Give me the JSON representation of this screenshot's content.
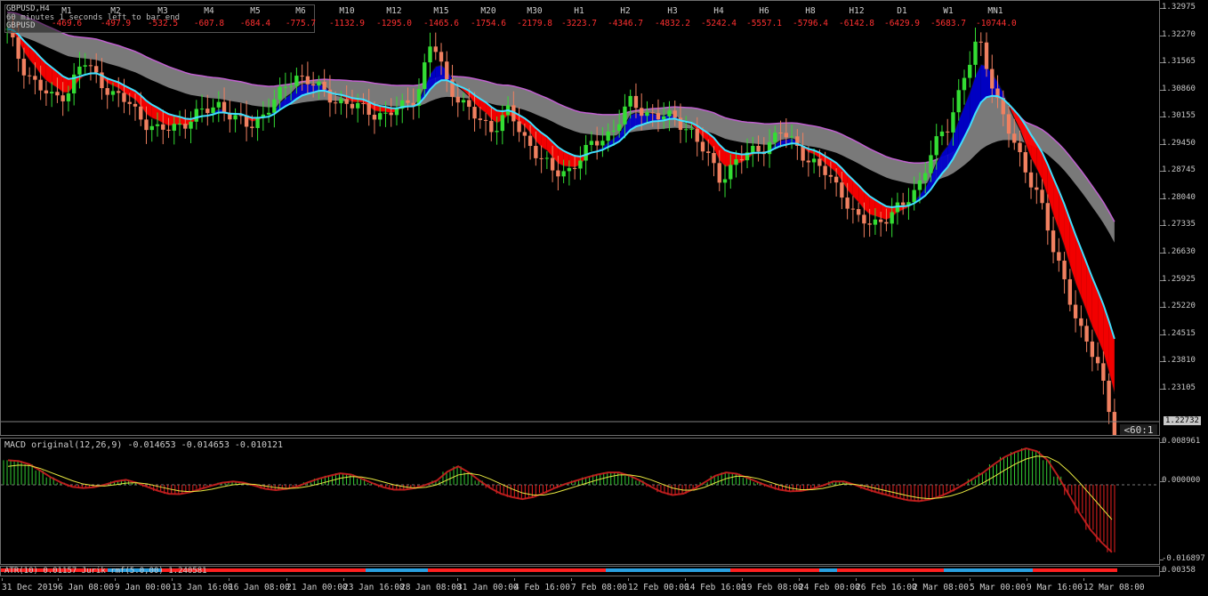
{
  "chart_title": "GBPUSD,H4",
  "countdown_text": "60 minutes 1 seconds left to bar end",
  "symbol_label": "GBPUSD",
  "timeframes": [
    {
      "name": "M1",
      "value": "-469.6"
    },
    {
      "name": "M2",
      "value": "-497.9"
    },
    {
      "name": "M3",
      "value": "-532.5"
    },
    {
      "name": "M4",
      "value": "-607.8"
    },
    {
      "name": "M5",
      "value": "-684.4"
    },
    {
      "name": "M6",
      "value": "-775.7"
    },
    {
      "name": "M10",
      "value": "-1132.9"
    },
    {
      "name": "M12",
      "value": "-1295.0"
    },
    {
      "name": "M15",
      "value": "-1465.6"
    },
    {
      "name": "M20",
      "value": "-1754.6"
    },
    {
      "name": "M30",
      "value": "-2179.8"
    },
    {
      "name": "H1",
      "value": "-3223.7"
    },
    {
      "name": "H2",
      "value": "-4346.7"
    },
    {
      "name": "H3",
      "value": "-4832.2"
    },
    {
      "name": "H4",
      "value": "-5242.4"
    },
    {
      "name": "H6",
      "value": "-5557.1"
    },
    {
      "name": "H8",
      "value": "-5796.4"
    },
    {
      "name": "H12",
      "value": "-6142.8"
    },
    {
      "name": "D1",
      "value": "-6429.9"
    },
    {
      "name": "W1",
      "value": "-5683.7"
    },
    {
      "name": "MN1",
      "value": "-10744.0"
    }
  ],
  "price_ticks": [
    "1.32975",
    "1.32270",
    "1.31565",
    "1.30860",
    "1.30155",
    "1.29450",
    "1.28745",
    "1.28040",
    "1.27335",
    "1.26630",
    "1.25925",
    "1.25220",
    "1.24515",
    "1.23810",
    "1.23105"
  ],
  "current_price": "1.22732",
  "bar_countdown_short": "<60:1",
  "macd": {
    "label": "MACD original(12,26,9) -0.014653 -0.014653 -0.010121",
    "ticks": [
      "0.008961",
      "0.000000",
      "-0.016897"
    ]
  },
  "atr": {
    "label": "ATR(10) 0.01157 Jurik rmf(5.0,00) 1.240581",
    "ticks": [
      "0.00358"
    ]
  },
  "time_labels": [
    "31 Dec 2019",
    "6 Jan 08:00",
    "9 Jan 00:00",
    "13 Jan 16:00",
    "16 Jan 08:00",
    "21 Jan 00:00",
    "23 Jan 16:00",
    "28 Jan 08:00",
    "31 Jan 00:00",
    "4 Feb 16:00",
    "7 Feb 08:00",
    "12 Feb 00:00",
    "14 Feb 16:00",
    "19 Feb 08:00",
    "24 Feb 00:00",
    "26 Feb 16:00",
    "2 Mar 08:00",
    "5 Mar 00:00",
    "9 Mar 16:00",
    "12 Mar 08:00"
  ],
  "colors": {
    "bull_candle": "#33dd33",
    "bear_candle": "#f08060",
    "bull_cloud": "#0000cc",
    "bear_cloud": "#ff0000",
    "slow_cloud": "#808080",
    "fast_ma": "#40e0ff",
    "macd_signal": "#e8e840"
  },
  "chart_data": [
    {
      "type": "line",
      "ylim": [
        1.227,
        1.3305
      ],
      "y": [
        1.323,
        1.315,
        1.31,
        1.307,
        1.309,
        1.316,
        1.312,
        1.308,
        1.306,
        1.302,
        1.299,
        1.3005,
        1.302,
        1.304,
        1.306,
        1.302,
        1.3005,
        1.304,
        1.308,
        1.313,
        1.311,
        1.308,
        1.3065,
        1.305,
        1.304,
        1.303,
        1.305,
        1.308,
        1.321,
        1.311,
        1.306,
        1.302,
        1.3,
        1.304,
        1.298,
        1.294,
        1.289,
        1.29,
        1.294,
        1.297,
        1.3,
        1.306,
        1.304,
        1.303,
        1.302,
        1.3,
        1.294,
        1.288,
        1.292,
        1.294,
        1.296,
        1.299,
        1.296,
        1.292,
        1.289,
        1.285,
        1.278,
        1.277,
        1.279,
        1.281,
        1.286,
        1.295,
        1.3,
        1.312,
        1.321,
        1.31,
        1.3,
        1.29,
        1.285,
        1.27,
        1.26,
        1.25,
        1.242,
        1.228
      ]
    },
    {
      "type": "bar",
      "ylim": [
        -0.0185,
        0.01
      ],
      "values": [
        0.006,
        0.0058,
        0.005,
        0.0035,
        0.0018,
        0.0005,
        -0.0005,
        -0.0008,
        -0.0006,
        0.0,
        0.0008,
        0.0012,
        0.0005,
        -0.0005,
        -0.0015,
        -0.0022,
        -0.0023,
        -0.0018,
        -0.001,
        -0.0002,
        0.0005,
        0.0008,
        0.0005,
        -0.0002,
        -0.001,
        -0.0013,
        -0.001,
        -0.0004,
        0.0006,
        0.0015,
        0.0022,
        0.0028,
        0.0025,
        0.0015,
        0.0004,
        -0.0006,
        -0.0012,
        -0.0012,
        -0.0008,
        0.0,
        0.001,
        0.0032,
        0.0045,
        0.003,
        0.001,
        -0.0008,
        -0.0022,
        -0.003,
        -0.0035,
        -0.003,
        -0.002,
        -0.0008,
        0.0002,
        0.001,
        0.0018,
        0.0025,
        0.003,
        0.003,
        0.0022,
        0.001,
        -0.0005,
        -0.0018,
        -0.0025,
        -0.0022,
        -0.001,
        0.0006,
        0.0022,
        0.003,
        0.0027,
        0.0017,
        0.0006,
        -0.0004,
        -0.0012,
        -0.0016,
        -0.0015,
        -0.001,
        -0.0002,
        0.0008,
        0.0008,
        0.0,
        -0.001,
        -0.0018,
        -0.0025,
        -0.0032,
        -0.0038,
        -0.004,
        -0.0036,
        -0.0028,
        -0.0016,
        -0.0002,
        0.0014,
        0.003,
        0.005,
        0.0068,
        0.008,
        0.0089,
        0.0082,
        0.006,
        0.002,
        -0.0025,
        -0.007,
        -0.011,
        -0.014,
        -0.0165
      ],
      "signal": [
        0.0045,
        0.0048,
        0.0047,
        0.004,
        0.003,
        0.002,
        0.001,
        0.0002,
        -0.0002,
        -0.0003,
        0.0,
        0.0004,
        0.0005,
        0.0002,
        -0.0004,
        -0.001,
        -0.0015,
        -0.0017,
        -0.0015,
        -0.0011,
        -0.0005,
        0.0,
        0.0002,
        0.0001,
        -0.0003,
        -0.0007,
        -0.0009,
        -0.0008,
        -0.0004,
        0.0002,
        0.0009,
        0.0016,
        0.002,
        0.0019,
        0.0014,
        0.0007,
        0.0,
        -0.0005,
        -0.0008,
        -0.0006,
        0.0,
        0.0012,
        0.0024,
        0.0028,
        0.0024,
        0.0014,
        0.0002,
        -0.001,
        -0.002,
        -0.0025,
        -0.0025,
        -0.002,
        -0.0012,
        -0.0004,
        0.0004,
        0.0012,
        0.0019,
        0.0024,
        0.0024,
        0.002,
        0.0012,
        0.0002,
        -0.0008,
        -0.0013,
        -0.0013,
        -0.0006,
        0.0005,
        0.0015,
        0.0021,
        0.002,
        0.0015,
        0.0007,
        -0.0001,
        -0.0008,
        -0.0012,
        -0.0012,
        -0.0009,
        -0.0003,
        0.0002,
        0.0001,
        -0.0003,
        -0.0009,
        -0.0015,
        -0.0021,
        -0.0027,
        -0.0032,
        -0.0034,
        -0.0032,
        -0.0027,
        -0.0019,
        -0.0008,
        0.0005,
        0.002,
        0.0036,
        0.0051,
        0.0063,
        0.007,
        0.0068,
        0.0055,
        0.0032,
        0.0005,
        -0.0025,
        -0.0055,
        -0.0085
      ]
    }
  ]
}
